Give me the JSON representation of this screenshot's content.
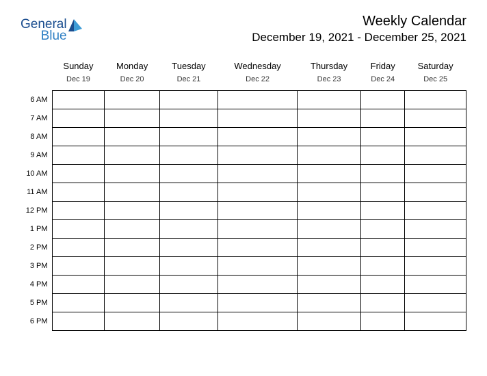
{
  "logo": {
    "word1": "General",
    "word2": "Blue"
  },
  "title": "Weekly Calendar",
  "date_range": "December 19, 2021 - December 25, 2021",
  "days": [
    {
      "name": "Sunday",
      "date": "Dec 19"
    },
    {
      "name": "Monday",
      "date": "Dec 20"
    },
    {
      "name": "Tuesday",
      "date": "Dec 21"
    },
    {
      "name": "Wednesday",
      "date": "Dec 22"
    },
    {
      "name": "Thursday",
      "date": "Dec 23"
    },
    {
      "name": "Friday",
      "date": "Dec 24"
    },
    {
      "name": "Saturday",
      "date": "Dec 25"
    }
  ],
  "hours": [
    "6 AM",
    "7 AM",
    "8 AM",
    "9 AM",
    "10 AM",
    "11 AM",
    "12 PM",
    "1 PM",
    "2 PM",
    "3 PM",
    "4 PM",
    "5 PM",
    "6 PM"
  ]
}
